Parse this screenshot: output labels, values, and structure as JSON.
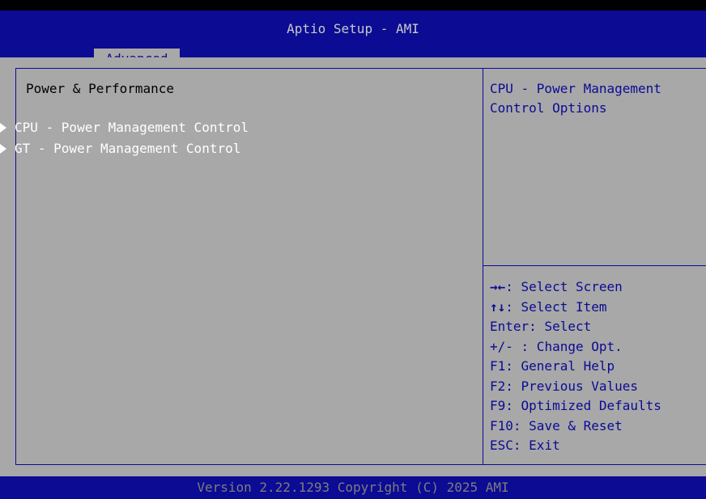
{
  "header": {
    "title": "Aptio Setup - AMI",
    "active_tab": "Advanced"
  },
  "main": {
    "section_title": "Power & Performance",
    "items": [
      {
        "label": "CPU - Power Management Control"
      },
      {
        "label": "GT - Power Management Control"
      }
    ]
  },
  "help": {
    "line1": "CPU - Power Management",
    "line2": "Control Options"
  },
  "keys": [
    {
      "key": "→←",
      "desc": ": Select Screen",
      "icon": "left-right-arrows-icon"
    },
    {
      "key": "↑↓",
      "desc": ": Select Item",
      "icon": "up-down-arrows-icon"
    },
    {
      "key": "Enter",
      "desc": ": Select"
    },
    {
      "key": "+/-",
      "desc": " : Change Opt."
    },
    {
      "key": "F1",
      "desc": ": General Help"
    },
    {
      "key": "F2",
      "desc": ": Previous Values"
    },
    {
      "key": "F9",
      "desc": ": Optimized Defaults"
    },
    {
      "key": "F10",
      "desc": ": Save & Reset"
    },
    {
      "key": "ESC",
      "desc": ": Exit"
    }
  ],
  "footer": {
    "version": "Version 2.22.1293 Copyright (C) 2025 AMI"
  },
  "colors": {
    "bar_blue": "#0b0b94",
    "panel_gray": "#a8a8a8",
    "selected_text": "#ffffff",
    "help_text": "#0b0b94"
  }
}
